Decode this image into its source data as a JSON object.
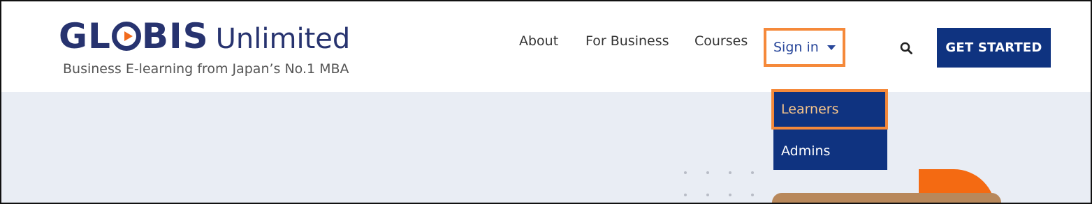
{
  "logo": {
    "word_part1": "GL",
    "word_part2": "BIS",
    "product": "Unlimited",
    "tagline": "Business E-learning from Japan’s No.1 MBA"
  },
  "nav": {
    "about": "About",
    "for_business": "For Business",
    "courses": "Courses",
    "sign_in": "Sign in",
    "get_started": "GET STARTED"
  },
  "sign_in_menu": {
    "items": [
      "Learners",
      "Admins"
    ]
  },
  "colors": {
    "brand_navy": "#0f3380",
    "highlight_orange": "#f5893a",
    "hero_bg": "#e9edf4"
  },
  "icons": {
    "search": "search-icon",
    "dropdown": "chevron-down-icon",
    "logo_play": "play-icon"
  }
}
